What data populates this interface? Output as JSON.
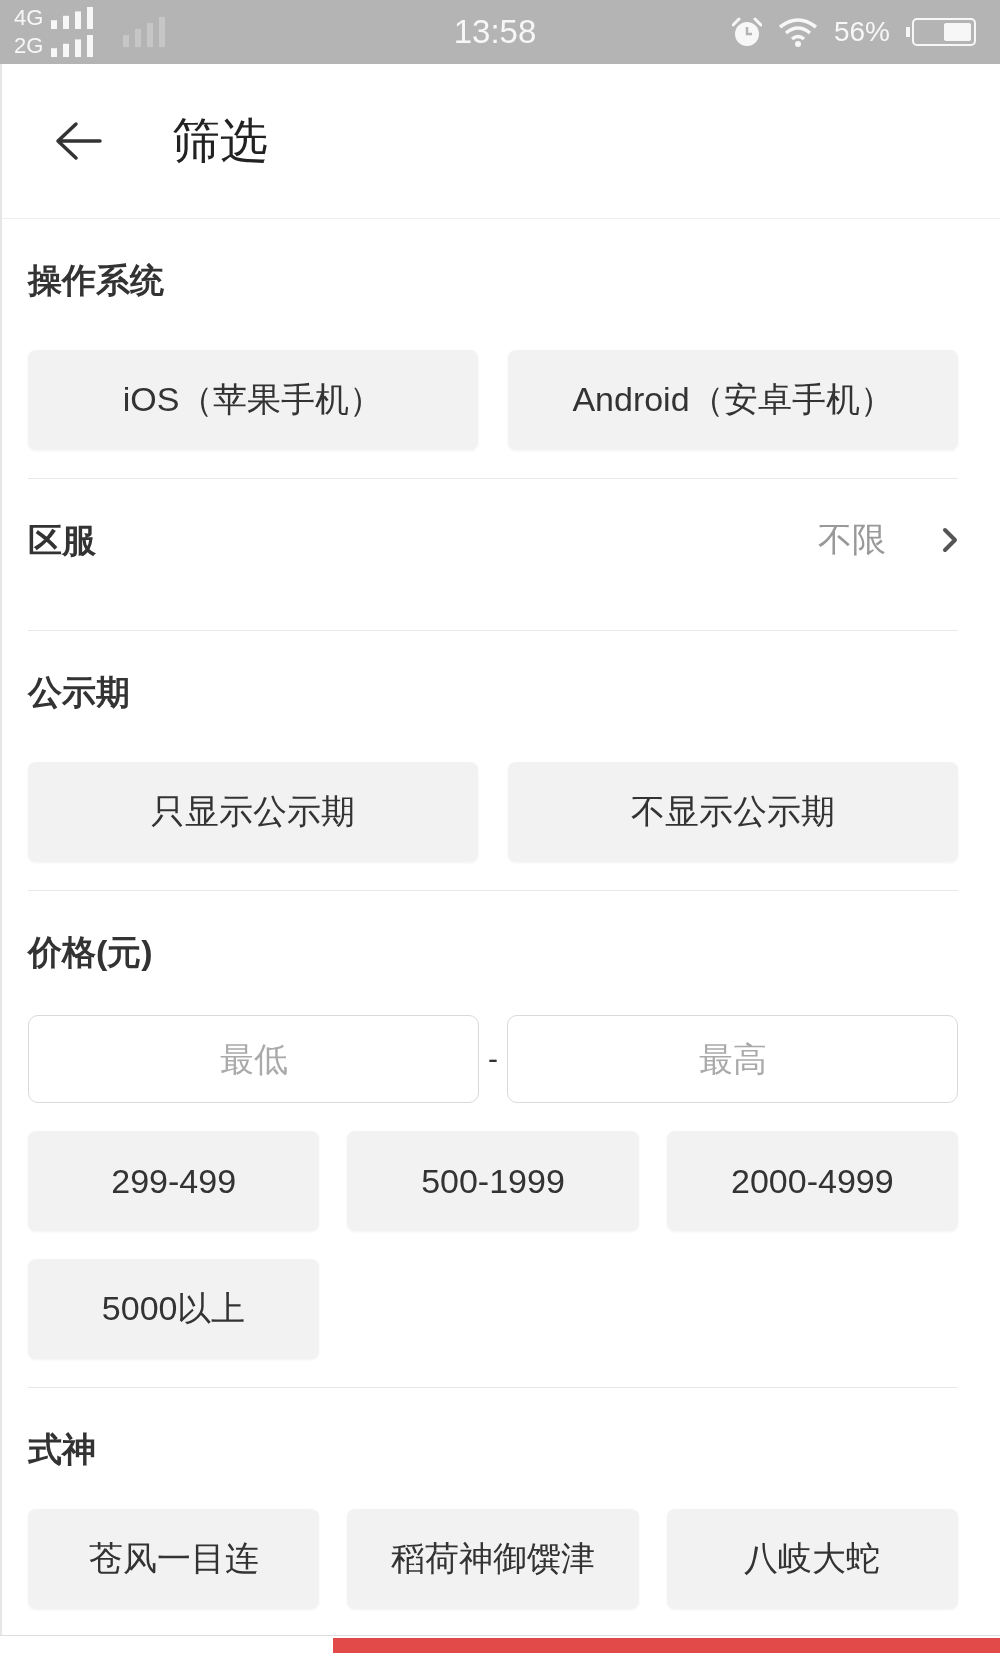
{
  "status_bar": {
    "network_labels": [
      "4G",
      "2G"
    ],
    "time": "13:58",
    "battery": "56%"
  },
  "header": {
    "title": "筛选"
  },
  "sections": [
    {
      "kind": "options",
      "title": "操作系统",
      "options": [
        {
          "label": "iOS（苹果手机）",
          "selected": false
        },
        {
          "label": "Android（安卓手机）",
          "selected": false
        }
      ]
    },
    {
      "kind": "link",
      "title": "区服",
      "value": "不限"
    },
    {
      "kind": "options",
      "title": "公示期",
      "options": [
        {
          "label": "只显示公示期",
          "selected": false
        },
        {
          "label": "不显示公示期",
          "selected": false
        }
      ]
    },
    {
      "kind": "price",
      "title": "价格(元)",
      "min": {
        "placeholder": "最低"
      },
      "separator": "-",
      "max": {
        "placeholder": "最高"
      },
      "options": [
        {
          "label": "299-499",
          "selected": false
        },
        {
          "label": "500-1999",
          "selected": false
        },
        {
          "label": "2000-4999",
          "selected": false
        },
        {
          "label": "5000以上",
          "selected": false
        }
      ]
    },
    {
      "kind": "options",
      "title": "式神",
      "options": [
        {
          "label": "苍风一目连",
          "selected": false
        },
        {
          "label": "稻荷神御馔津",
          "selected": false
        },
        {
          "label": "八岐大蛇",
          "selected": false
        }
      ]
    }
  ]
}
